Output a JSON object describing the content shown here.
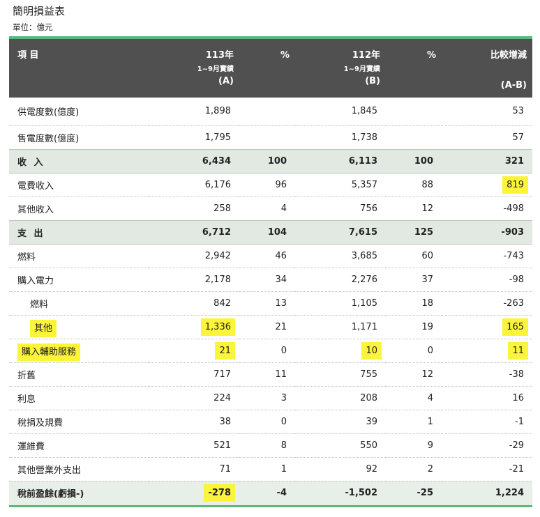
{
  "title": "簡明損益表",
  "unit": "單位：億元",
  "header": {
    "item": "項 目",
    "col113_line1": "113年",
    "col113_line2": "1~9月實績",
    "col113_line3": "(A)",
    "pct1": "%",
    "col112_line1": "112年",
    "col112_line2": "1~9月實績",
    "col112_line3": "(B)",
    "pct2": "%",
    "diff_line1": "比較增減",
    "diff_line3": "(A-B)"
  },
  "rows": [
    {
      "label": "供電度數(億度)",
      "a": "1,898",
      "pa": "",
      "b": "1,845",
      "pb": "",
      "diff": "53"
    },
    {
      "label": "售電度數(億度)",
      "a": "1,795",
      "pa": "",
      "b": "1,738",
      "pb": "",
      "diff": "57"
    },
    {
      "label": "收 入",
      "a": "6,434",
      "pa": "100",
      "b": "6,113",
      "pb": "100",
      "diff": "321"
    },
    {
      "label": "電費收入",
      "a": "6,176",
      "pa": "96",
      "b": "5,357",
      "pb": "88",
      "diff": "819"
    },
    {
      "label": "其他收入",
      "a": "258",
      "pa": "4",
      "b": "756",
      "pb": "12",
      "diff": "-498"
    },
    {
      "label": "支 出",
      "a": "6,712",
      "pa": "104",
      "b": "7,615",
      "pb": "125",
      "diff": "-903"
    },
    {
      "label": "燃料",
      "a": "2,942",
      "pa": "46",
      "b": "3,685",
      "pb": "60",
      "diff": "-743"
    },
    {
      "label": "購入電力",
      "a": "2,178",
      "pa": "34",
      "b": "2,276",
      "pb": "37",
      "diff": "-98"
    },
    {
      "label": "燃料",
      "a": "842",
      "pa": "13",
      "b": "1,105",
      "pb": "18",
      "diff": "-263"
    },
    {
      "label": "其他",
      "a": "1,336",
      "pa": "21",
      "b": "1,171",
      "pb": "19",
      "diff": "165"
    },
    {
      "label": "購入輔助服務",
      "a": "21",
      "pa": "0",
      "b": "10",
      "pb": "0",
      "diff": "11"
    },
    {
      "label": "折舊",
      "a": "717",
      "pa": "11",
      "b": "755",
      "pb": "12",
      "diff": "-38"
    },
    {
      "label": "利息",
      "a": "224",
      "pa": "3",
      "b": "208",
      "pb": "4",
      "diff": "16"
    },
    {
      "label": "稅捐及規費",
      "a": "38",
      "pa": "0",
      "b": "39",
      "pb": "1",
      "diff": "-1"
    },
    {
      "label": "運維費",
      "a": "521",
      "pa": "8",
      "b": "550",
      "pb": "9",
      "diff": "-29"
    },
    {
      "label": "其他營業外支出",
      "a": "71",
      "pa": "1",
      "b": "92",
      "pb": "2",
      "diff": "-21"
    },
    {
      "label": "稅前盈餘(虧損-)",
      "a": "-278",
      "pa": "-4",
      "b": "-1,502",
      "pb": "-25",
      "diff": "1,224"
    }
  ],
  "highlight_color": "#fbf43a",
  "header_bg": "#505050",
  "section_bg": "#e1e9e2",
  "accent_green": "#5bb978"
}
